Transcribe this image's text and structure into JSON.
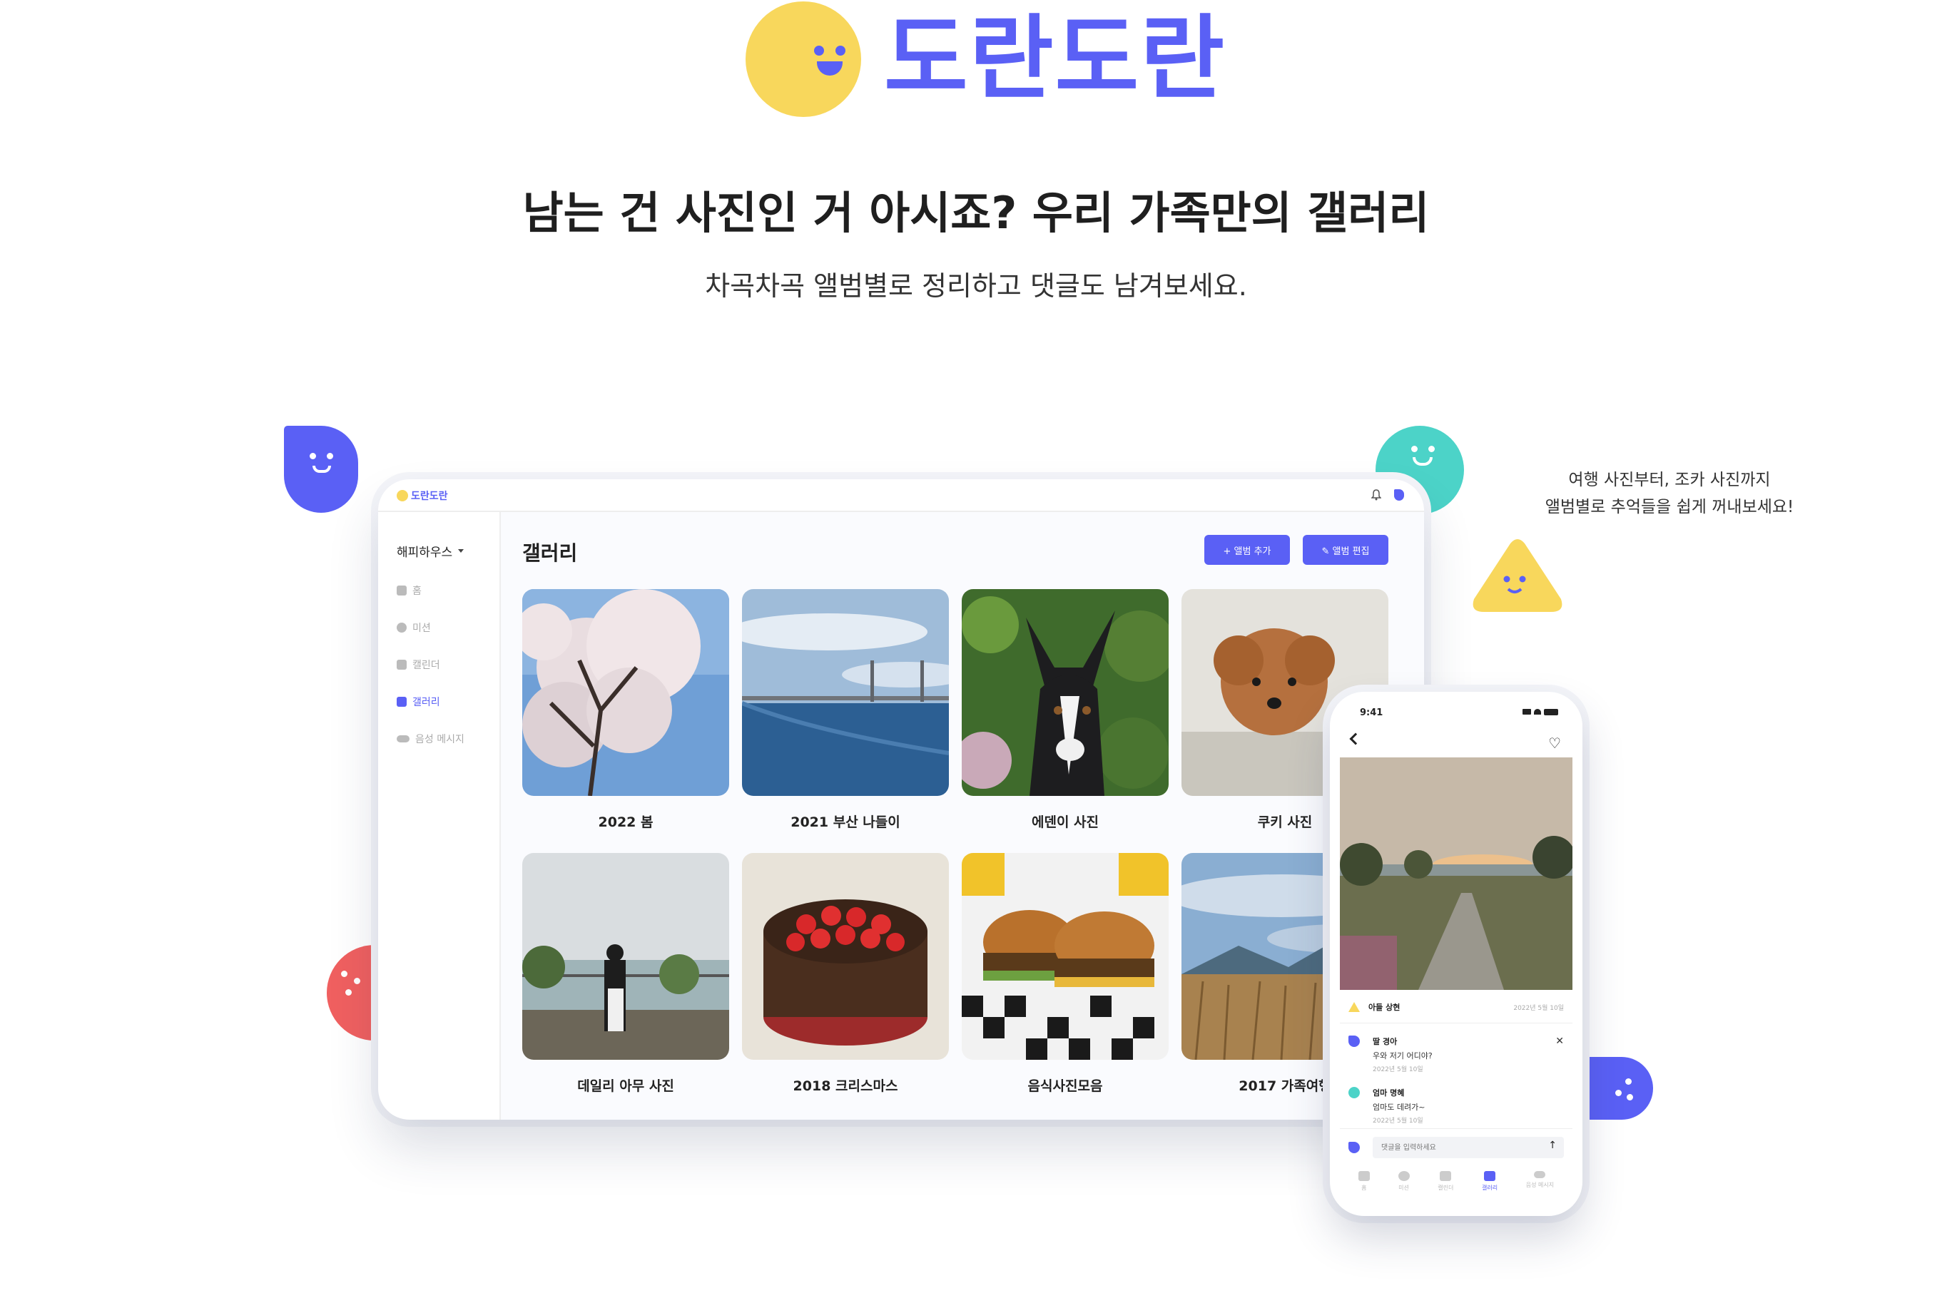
{
  "hero": {
    "logo_text": "도란도란",
    "title": "남는 건 사진인 거 아시죠? 우리 가족만의 갤러리",
    "subtitle": "차곡차곡 앨범별로 정리하고 댓글도 남겨보세요."
  },
  "side_note": {
    "line1": "여행 사진부터, 조카 사진까지",
    "line2": "앨범별로 추억들을 쉽게 꺼내보세요!"
  },
  "colors": {
    "brand": "#5a60f5",
    "yellow": "#f8d75c",
    "teal": "#4cd3c8",
    "red": "#f06060"
  },
  "tablet": {
    "brand": "도란도란",
    "family_name": "해피하우스",
    "nav": [
      {
        "label": "홈",
        "icon": "home-icon"
      },
      {
        "label": "미션",
        "icon": "check-circle-icon"
      },
      {
        "label": "캘린더",
        "icon": "calendar-icon"
      },
      {
        "label": "갤러리",
        "icon": "gallery-icon"
      },
      {
        "label": "음성 메시지",
        "icon": "voicemail-icon"
      }
    ],
    "page_title": "갤러리",
    "add_album": "+ 앨범 추가",
    "edit_album": "✎ 앨범 편집",
    "albums": [
      {
        "label": "2022 봄"
      },
      {
        "label": "2021 부산 나들이"
      },
      {
        "label": "에덴이 사진"
      },
      {
        "label": "쿠키 사진"
      },
      {
        "label": "데일리 아무 사진"
      },
      {
        "label": "2018 크리스마스"
      },
      {
        "label": "음식사진모음"
      },
      {
        "label": "2017 가족여행"
      }
    ]
  },
  "phone": {
    "time": "9:41",
    "author": "아들 상현",
    "author_date": "2022년 5월 10일",
    "comments": [
      {
        "name": "딸 경아",
        "text": "우와 저기 어디야?",
        "date": "2022년 5월 10일"
      },
      {
        "name": "엄마 명혜",
        "text": "엄마도 데려가~",
        "date": "2022년 5월 10일"
      }
    ],
    "input_placeholder": "댓글을 입력하세요",
    "tabs": [
      {
        "label": "홈"
      },
      {
        "label": "미션"
      },
      {
        "label": "캘린더"
      },
      {
        "label": "갤러리"
      },
      {
        "label": "음성 메시지"
      }
    ]
  }
}
